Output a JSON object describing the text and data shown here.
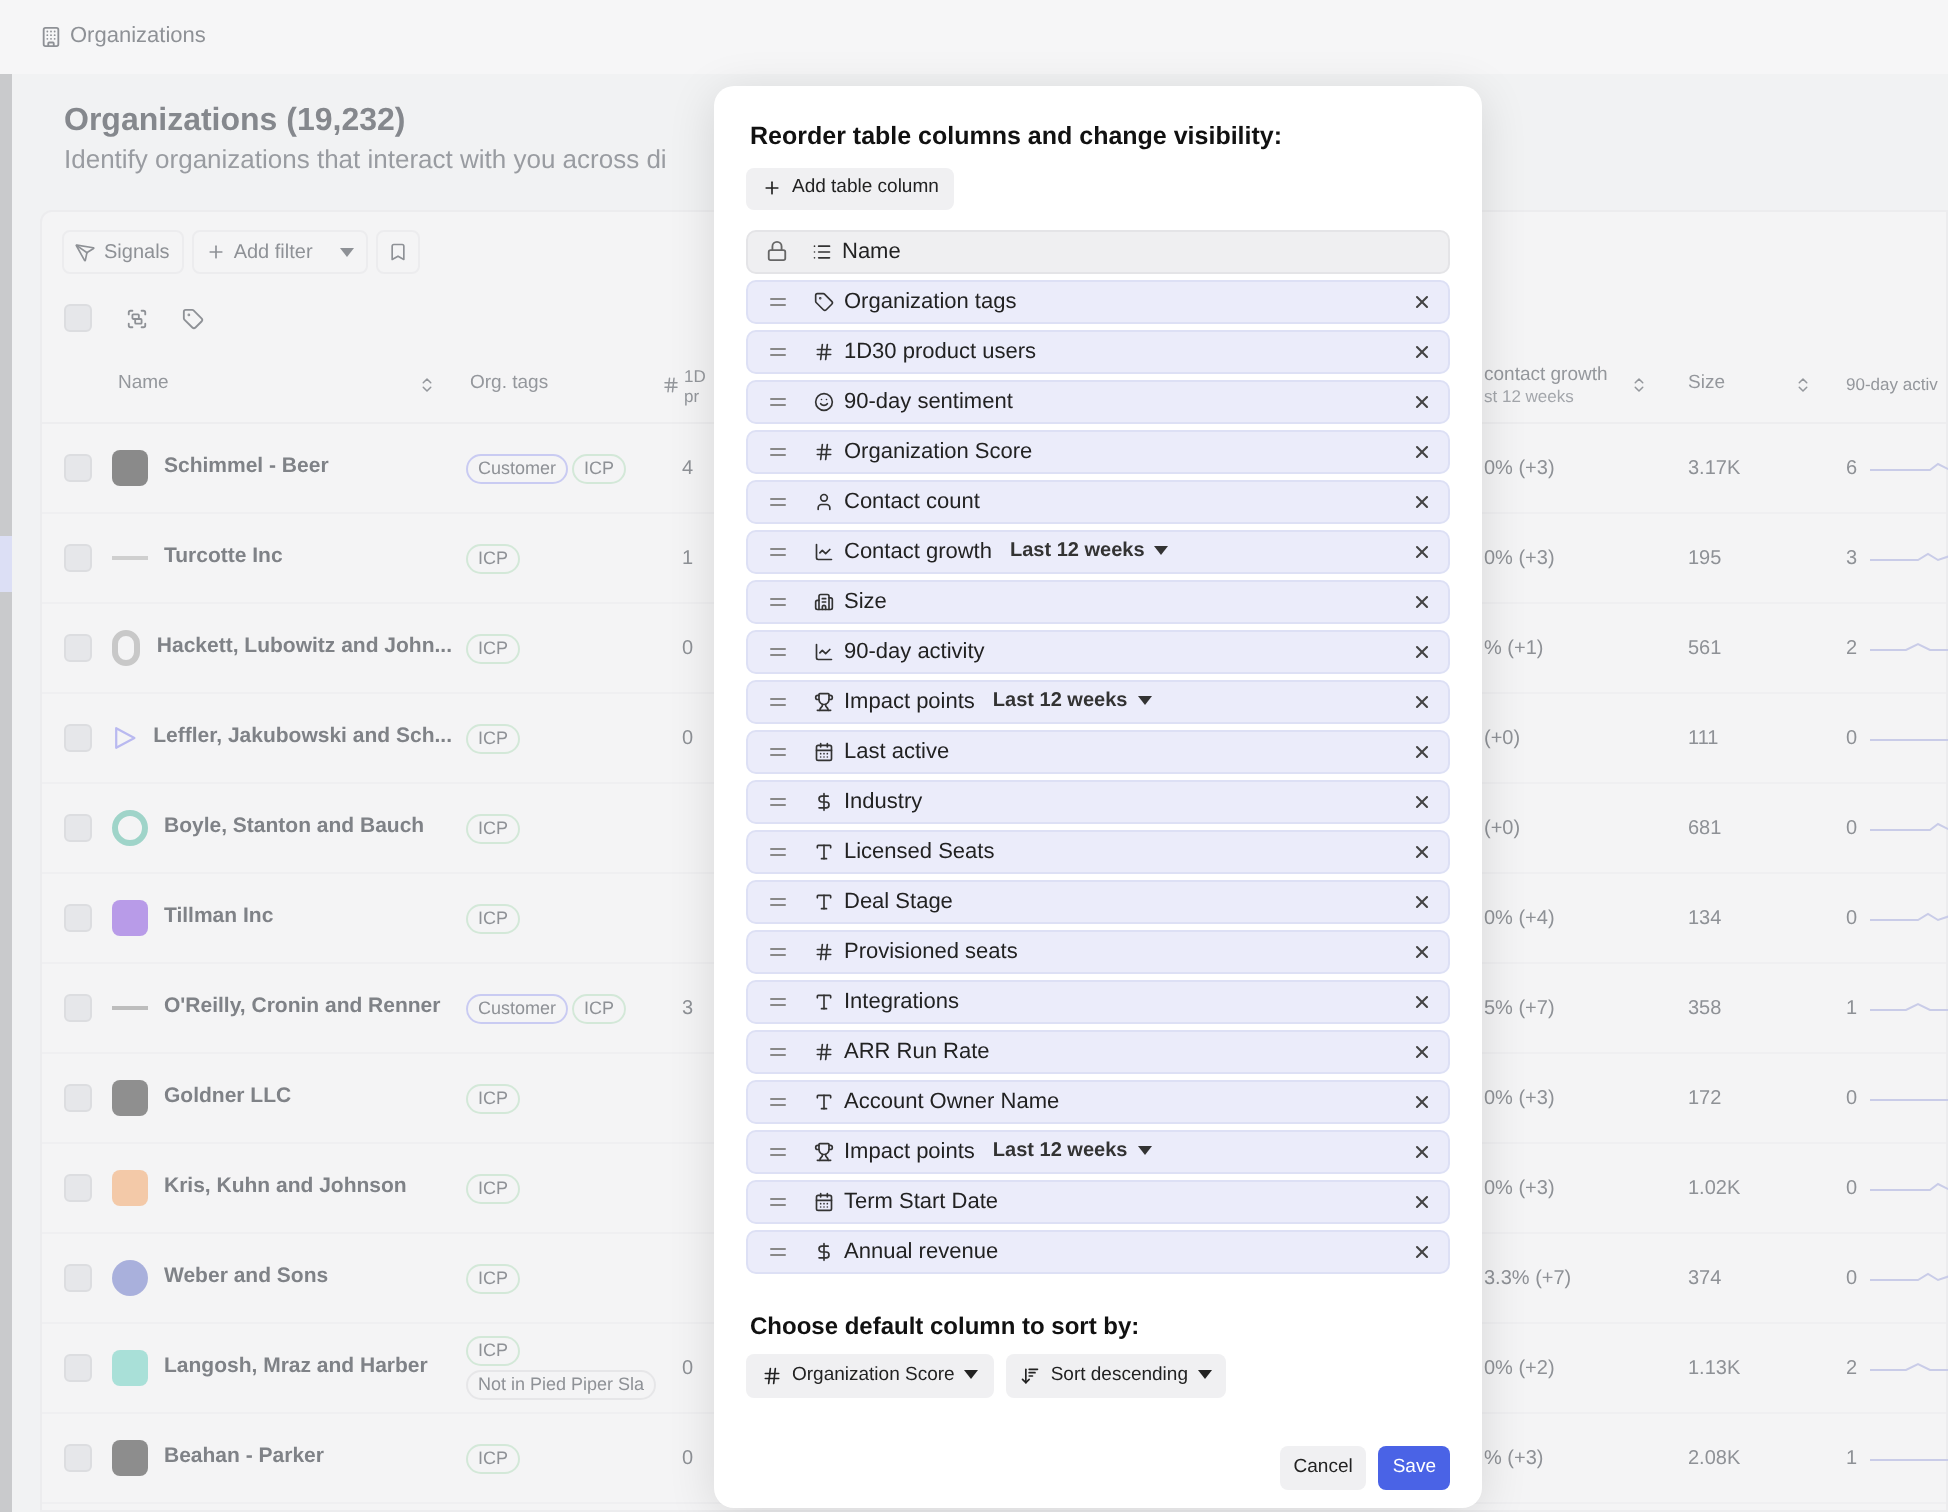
{
  "breadcrumb": "Organizations",
  "page": {
    "title": "Organizations (19,232)",
    "subtitle": "Identify organizations that interact with you across di"
  },
  "toolbar": {
    "signals": "Signals",
    "add_filter": "Add filter"
  },
  "select_all": {
    "checked": false
  },
  "table": {
    "columns": [
      {
        "kind": "name",
        "label": "Name"
      },
      {
        "kind": "tags",
        "label": "Org. tags"
      },
      {
        "kind": "users",
        "label": "1D",
        "sub": "pr"
      },
      {
        "kind": "growth",
        "label": "contact growth",
        "sub": "st 12 weeks"
      },
      {
        "kind": "size",
        "label": "Size"
      },
      {
        "kind": "activity",
        "label": "90-day activ"
      }
    ],
    "rows": [
      {
        "checked": false,
        "name": "Schimmel - Beer",
        "logo": {
          "kind": "tile",
          "color": "#8a8a8a"
        },
        "tags": [
          {
            "label": "Customer",
            "color": "#c9cbf2"
          },
          {
            "label": "ICP",
            "color": "#d3e8d8"
          }
        ],
        "users": "4",
        "growth": "0% (+3)",
        "size": "3.17K",
        "activity": "6"
      },
      {
        "checked": false,
        "name": "Turcotte Inc",
        "logo": {
          "kind": "line",
          "color": "#cfcfcf"
        },
        "tags": [
          {
            "label": "ICP",
            "color": "#d3e8d8"
          }
        ],
        "users": "1",
        "growth": "0% (+3)",
        "size": "195",
        "activity": "3"
      },
      {
        "checked": false,
        "name": "Hackett, Lubowitz and John...",
        "logo": {
          "kind": "ring",
          "color": "#c8c8c8"
        },
        "tags": [
          {
            "label": "ICP",
            "color": "#d3e8d8"
          }
        ],
        "users": "0",
        "growth": "% (+1)",
        "size": "561",
        "activity": "2"
      },
      {
        "checked": false,
        "name": "Leffler, Jakubowski and Sch...",
        "logo": {
          "kind": "play",
          "color": "#b9b9f0"
        },
        "tags": [
          {
            "label": "ICP",
            "color": "#d3e8d8"
          }
        ],
        "users": "0",
        "growth": "(+0)",
        "size": "111",
        "activity": "0"
      },
      {
        "checked": false,
        "name": "Boyle, Stanton and Bauch",
        "logo": {
          "kind": "ring",
          "color": "#9fd4c9"
        },
        "tags": [
          {
            "label": "ICP",
            "color": "#d3e8d8"
          }
        ],
        "growth": "(+0)",
        "size": "681",
        "activity": "0"
      },
      {
        "checked": false,
        "name": "Tillman Inc",
        "logo": {
          "kind": "tile",
          "color": "#b89be8"
        },
        "tags": [
          {
            "label": "ICP",
            "color": "#d3e8d8"
          }
        ],
        "growth": "0% (+4)",
        "size": "134",
        "activity": "0"
      },
      {
        "checked": false,
        "name": "O'Reilly, Cronin and Renner",
        "logo": {
          "kind": "line",
          "color": "#bdbdbd"
        },
        "tags": [
          {
            "label": "Customer",
            "color": "#c9cbf2"
          },
          {
            "label": "ICP",
            "color": "#d3e8d8"
          }
        ],
        "users": "3",
        "growth": "5% (+7)",
        "size": "358",
        "activity": "1"
      },
      {
        "checked": false,
        "name": "Goldner LLC",
        "logo": {
          "kind": "tile",
          "color": "#8f8f8f"
        },
        "tags": [
          {
            "label": "ICP",
            "color": "#d3e8d8"
          }
        ],
        "growth": "0% (+3)",
        "size": "172",
        "activity": "0"
      },
      {
        "checked": false,
        "name": "Kris, Kuhn and Johnson",
        "logo": {
          "kind": "tile",
          "color": "#f3c9a8"
        },
        "tags": [
          {
            "label": "ICP",
            "color": "#d3e8d8"
          }
        ],
        "growth": "0% (+3)",
        "size": "1.02K",
        "activity": "0"
      },
      {
        "checked": false,
        "name": "Weber and Sons",
        "logo": {
          "kind": "circle",
          "color": "#a9b0dc"
        },
        "tags": [
          {
            "label": "ICP",
            "color": "#d3e8d8"
          }
        ],
        "growth": "3.3% (+7)",
        "size": "374",
        "activity": "0"
      },
      {
        "checked": false,
        "name": "Langosh, Mraz and Harber",
        "logo": {
          "kind": "tile",
          "color": "#a9e0d8"
        },
        "tags": [
          {
            "label": "ICP",
            "color": "#d3e8d8"
          },
          {
            "label": "Not in Pied Piper Sla",
            "color": "#e6e6e8"
          }
        ],
        "users": "0",
        "growth": "0% (+2)",
        "size": "1.13K",
        "activity": "2"
      },
      {
        "checked": false,
        "name": "Beahan - Parker",
        "logo": {
          "kind": "tile",
          "color": "#8d8d8d"
        },
        "tags": [
          {
            "label": "ICP",
            "color": "#d3e8d8"
          }
        ],
        "users": "0",
        "growth": "% (+3)",
        "size": "2.08K",
        "activity": "1"
      }
    ]
  },
  "dialog": {
    "title": "Reorder table columns and change visibility:",
    "add_button": "Add table column",
    "columns": [
      {
        "label": "Name",
        "kind": "list",
        "locked": true
      },
      {
        "label": "Organization tags",
        "kind": "tags",
        "locked": false
      },
      {
        "label": "1D30 product users",
        "kind": "number",
        "locked": false
      },
      {
        "label": "90-day sentiment",
        "kind": "sentiment",
        "locked": false
      },
      {
        "label": "Organization Score",
        "kind": "number",
        "locked": false
      },
      {
        "label": "Contact count",
        "kind": "person",
        "locked": false
      },
      {
        "label": "Contact growth",
        "kind": "trend",
        "locked": false,
        "period": "Last 12 weeks"
      },
      {
        "label": "Size",
        "kind": "company",
        "locked": false
      },
      {
        "label": "90-day activity",
        "kind": "trend",
        "locked": false
      },
      {
        "label": "Impact points",
        "kind": "points",
        "locked": false,
        "period": "Last 12 weeks"
      },
      {
        "label": "Last active",
        "kind": "date",
        "locked": false
      },
      {
        "label": "Industry",
        "kind": "currency",
        "locked": false
      },
      {
        "label": "Licensed Seats",
        "kind": "text",
        "locked": false
      },
      {
        "label": "Deal Stage",
        "kind": "text",
        "locked": false
      },
      {
        "label": "Provisioned seats",
        "kind": "number",
        "locked": false
      },
      {
        "label": "Integrations",
        "kind": "text",
        "locked": false
      },
      {
        "label": "ARR Run Rate",
        "kind": "number",
        "locked": false
      },
      {
        "label": "Account Owner Name",
        "kind": "text",
        "locked": false
      },
      {
        "label": "Impact points",
        "kind": "points",
        "locked": false,
        "period": "Last 12 weeks"
      },
      {
        "label": "Term Start Date",
        "kind": "date",
        "locked": false
      },
      {
        "label": "Annual revenue",
        "kind": "currency",
        "locked": false
      }
    ],
    "sort_title": "Choose default column to sort by:",
    "sort_column": {
      "label": "Organization Score",
      "kind": "number"
    },
    "sort_order": "Sort descending",
    "buttons": [
      {
        "label": "Cancel",
        "kind": "secondary"
      },
      {
        "label": "Save",
        "kind": "primary"
      }
    ]
  }
}
